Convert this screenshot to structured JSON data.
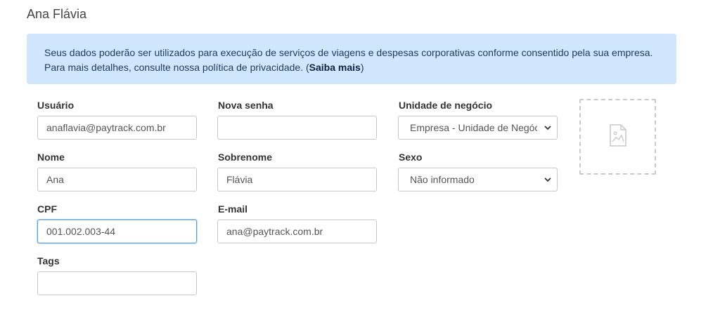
{
  "page": {
    "title": "Ana Flávia"
  },
  "notice": {
    "text": "Seus dados poderão ser utilizados para execução de serviços de viagens e despesas corporativas conforme consentido pela sua empresa. Para mais detalhes, consulte nossa política de privacidade. (",
    "link_label": "Saiba mais",
    "text_end": ")"
  },
  "form": {
    "usuario": {
      "label": "Usuário",
      "value": "anaflavia@paytrack.com.br"
    },
    "nova_senha": {
      "label": "Nova senha",
      "value": ""
    },
    "unidade": {
      "label": "Unidade de negócio",
      "selected": "Empresa - Unidade de Negócio"
    },
    "nome": {
      "label": "Nome",
      "value": "Ana"
    },
    "sobrenome": {
      "label": "Sobrenome",
      "value": "Flávia"
    },
    "sexo": {
      "label": "Sexo",
      "selected": "Não informado"
    },
    "cpf": {
      "label": "CPF",
      "value": "001.002.003-44"
    },
    "email": {
      "label": "E-mail",
      "value": "ana@paytrack.com.br"
    },
    "tags": {
      "label": "Tags",
      "value": ""
    }
  },
  "photo": {
    "icon": "image-file-icon"
  },
  "colors": {
    "notice_bg": "#cfe6fd",
    "focus_border": "#4e9ee8"
  }
}
